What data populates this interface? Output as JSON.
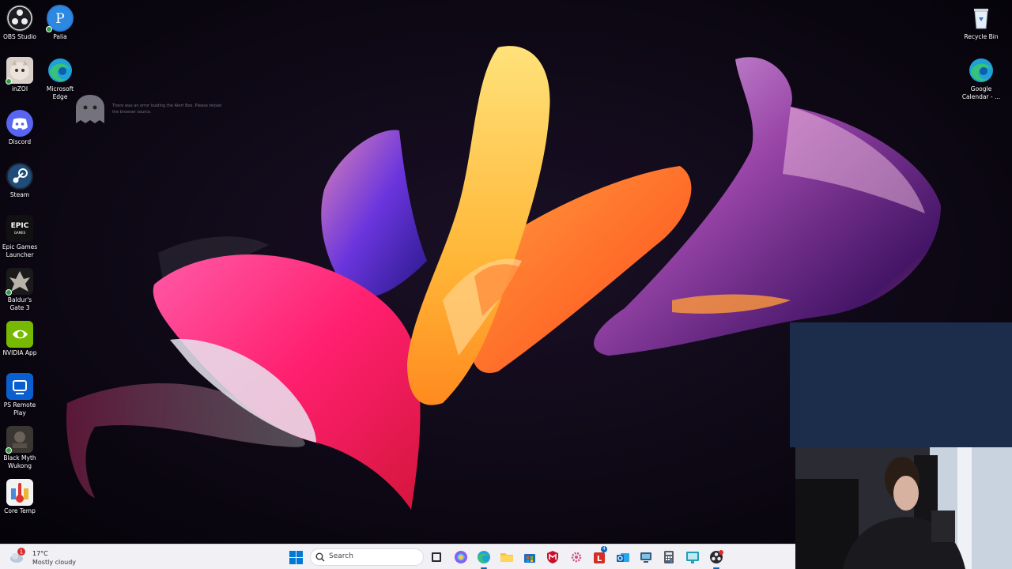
{
  "desktop": {
    "left_column": [
      {
        "label": "OBS Studio"
      },
      {
        "label": "inZOI"
      },
      {
        "label": "Discord"
      },
      {
        "label": "Steam"
      },
      {
        "label": "Epic Games Launcher"
      },
      {
        "label": "Baldur's Gate 3"
      },
      {
        "label": "NVIDIA App"
      },
      {
        "label": "PS Remote Play"
      },
      {
        "label": "Black Myth Wukong"
      },
      {
        "label": "Core Temp"
      }
    ],
    "second_column": [
      {
        "label": "Palia"
      },
      {
        "label": "Microsoft Edge"
      }
    ],
    "right_column": [
      {
        "label": "Recycle Bin"
      },
      {
        "label": "Google Calendar - ..."
      }
    ],
    "ghost_message": "There was an error loading the Alert Box. Please reload the browser source."
  },
  "taskbar": {
    "weather": {
      "temp": "17°C",
      "condition": "Mostly cloudy",
      "alert_count": "1"
    },
    "search_placeholder": "Search",
    "notification_badge": "4"
  },
  "colors": {
    "taskbar_bg": "#f1f0f4",
    "overlay_panel": "#1c2d4c",
    "accent": "#0067c0"
  }
}
